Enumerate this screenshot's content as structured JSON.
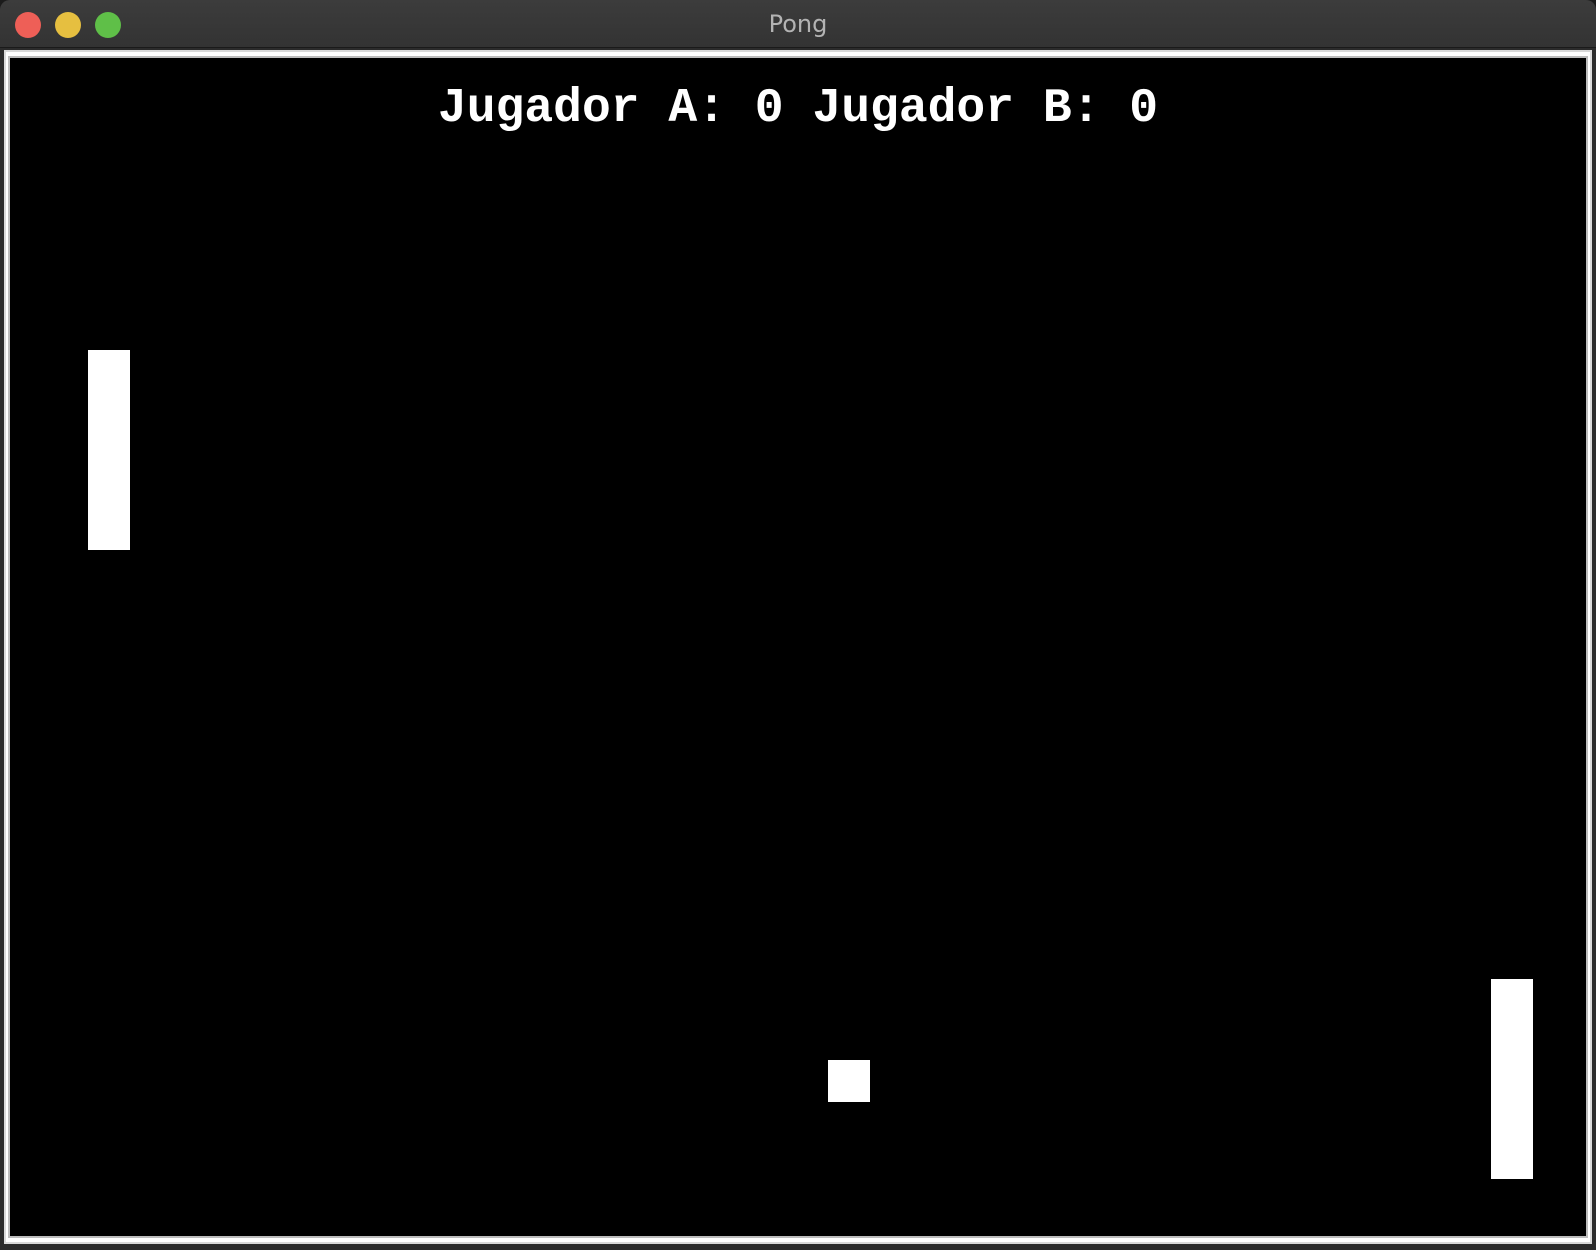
{
  "window": {
    "title": "Pong",
    "controls": {
      "close_color": "#ee5f57",
      "minimize_color": "#e6bf40",
      "zoom_color": "#5fbf48"
    }
  },
  "game": {
    "background_color": "#000000",
    "foreground_color": "#ffffff",
    "scoreboard": {
      "player_a_label": "Jugador A:",
      "player_a_score": 0,
      "player_b_label": "Jugador B:",
      "player_b_score": 0
    },
    "objects": {
      "left_paddle": "paddle",
      "right_paddle": "paddle",
      "ball": "ball"
    }
  }
}
